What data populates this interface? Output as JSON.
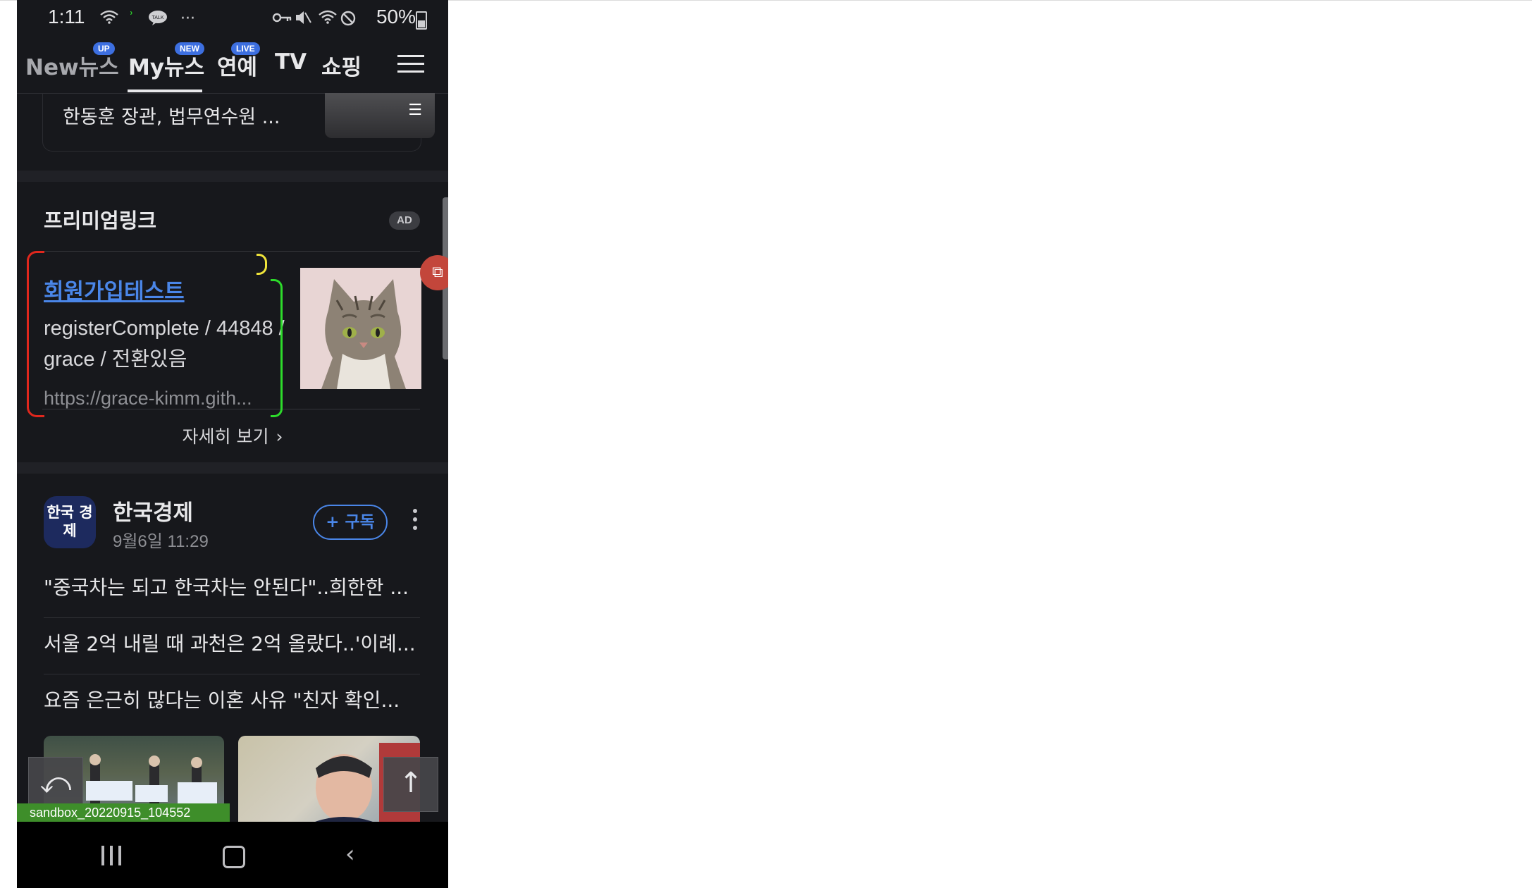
{
  "status_bar": {
    "time": "1:11",
    "battery": "50%",
    "talk_icon_label": "TALK",
    "more": "···"
  },
  "tabs": [
    {
      "label": "New뉴스",
      "badge": "UP"
    },
    {
      "label": "My뉴스",
      "badge": "NEW"
    },
    {
      "label": "연예",
      "badge": "LIVE"
    },
    {
      "label": "TV",
      "badge": ""
    },
    {
      "label": "쇼핑",
      "badge": ""
    }
  ],
  "previous_article": {
    "title": "한동훈 장관, 법무연수원 ..."
  },
  "premium": {
    "title": "프리미엄링크",
    "ad_badge": "AD",
    "ad_headline": "회원가입테스트",
    "ad_description": "registerComplete / 44848 / grace / 전환있음",
    "ad_url": "https://grace-kimm.gith...",
    "more_label": "자세히 보기"
  },
  "publisher": {
    "logo_text": "한국 경제",
    "name": "한국경제",
    "date": "9월6일 11:29",
    "subscribe_label": "+ 구독"
  },
  "headlines": [
    "\"중국차는 되고 한국차는 안된다\"..희한한 ...",
    "서울 2억 내릴 때 과천은 2억 올랐다..'이례...",
    "요즘 은근히 많다는 이혼 사유 \"친자 확인..."
  ],
  "sandbox_label": "sandbox_20220915_104552",
  "icons": {
    "back": "undo-arrow-icon",
    "top": "arrow-up-icon",
    "menu": "hamburger-icon"
  },
  "colors": {
    "accent": "#4a86e8",
    "background": "#17181c",
    "annotation_red": "#e0271d",
    "annotation_green": "#2ddb2b",
    "annotation_yellow": "#f0e43a"
  }
}
